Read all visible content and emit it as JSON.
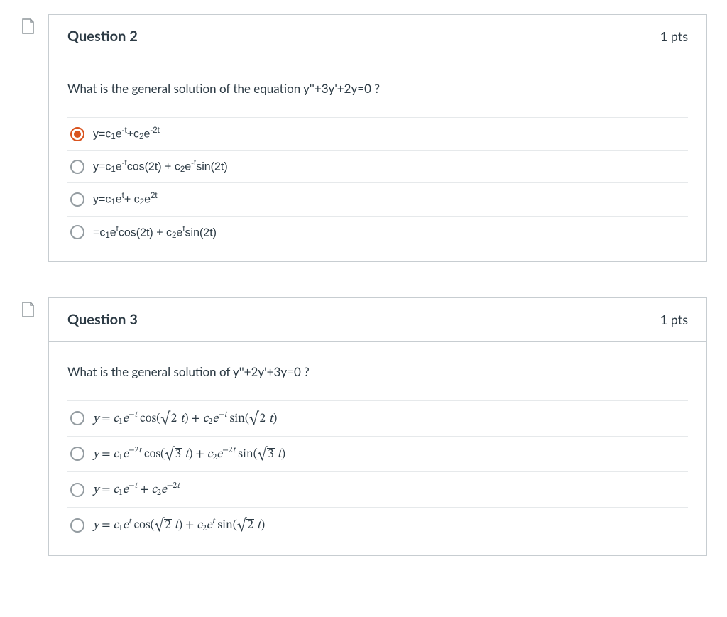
{
  "questions": [
    {
      "number": "Question 2",
      "points": "1 pts",
      "prompt": "What is the general solution of the equation y''+3y'+2y=0 ?",
      "selected_index": 0,
      "options": [
        {
          "html": "y=c<sub>1</sub>e<sup>-t</sup>+c<sub>2</sub>e<sup>-2t</sup>"
        },
        {
          "html": "y=c<sub>1</sub>e<sup>-t</sup>cos(2t) + c<sub>2</sub>e<sup>-t</sup>sin(2t)"
        },
        {
          "html": "y=c<sub>1</sub>e<sup>t</sup>+ c<sub>2</sub>e<sup>2t</sup>"
        },
        {
          "html": "=c<sub>1</sub>e<sup>t</sup>cos(2t) + c<sub>2</sub>e<sup>t</sup>sin(2t)"
        }
      ]
    },
    {
      "number": "Question 3",
      "points": "1 pts",
      "prompt": "What is the general solution of y''+2y'+3y=0 ?",
      "selected_index": -1,
      "options": [
        {
          "html": "<span class='math'><i>y</i> = <i>c</i><sub>1</sub><i>e</i><sup>−<i>t</i></sup> cos(<span class='sqrt'><span>2</span></span> <i>t</i>) + <i>c</i><sub>2</sub><i>e</i><sup>−<i>t</i></sup> sin(<span class='sqrt'><span>2</span></span> <i>t</i>)</span>"
        },
        {
          "html": "<span class='math'><i>y</i> = <i>c</i><sub>1</sub><i>e</i><sup>−2<i>t</i></sup> cos(<span class='sqrt'><span>3</span></span> <i>t</i>) + <i>c</i><sub>2</sub><i>e</i><sup>−2<i>t</i></sup> sin(<span class='sqrt'><span>3</span></span> <i>t</i>)</span>"
        },
        {
          "html": "<span class='math'><i>y</i> = <i>c</i><sub>1</sub><i>e</i><sup>−<i>t</i></sup> + <i>c</i><sub>2</sub><i>e</i><sup>−2<i>t</i></sup></span>"
        },
        {
          "html": "<span class='math'><i>y</i> = <i>c</i><sub>1</sub><i>e</i><sup><i>t</i></sup> cos(<span class='sqrt'><span>2</span></span> <i>t</i>) + <i>c</i><sub>2</sub><i>e</i><sup><i>t</i></sup> sin(<span class='sqrt'><span>2</span></span> <i>t</i>)</span>"
        }
      ]
    }
  ]
}
